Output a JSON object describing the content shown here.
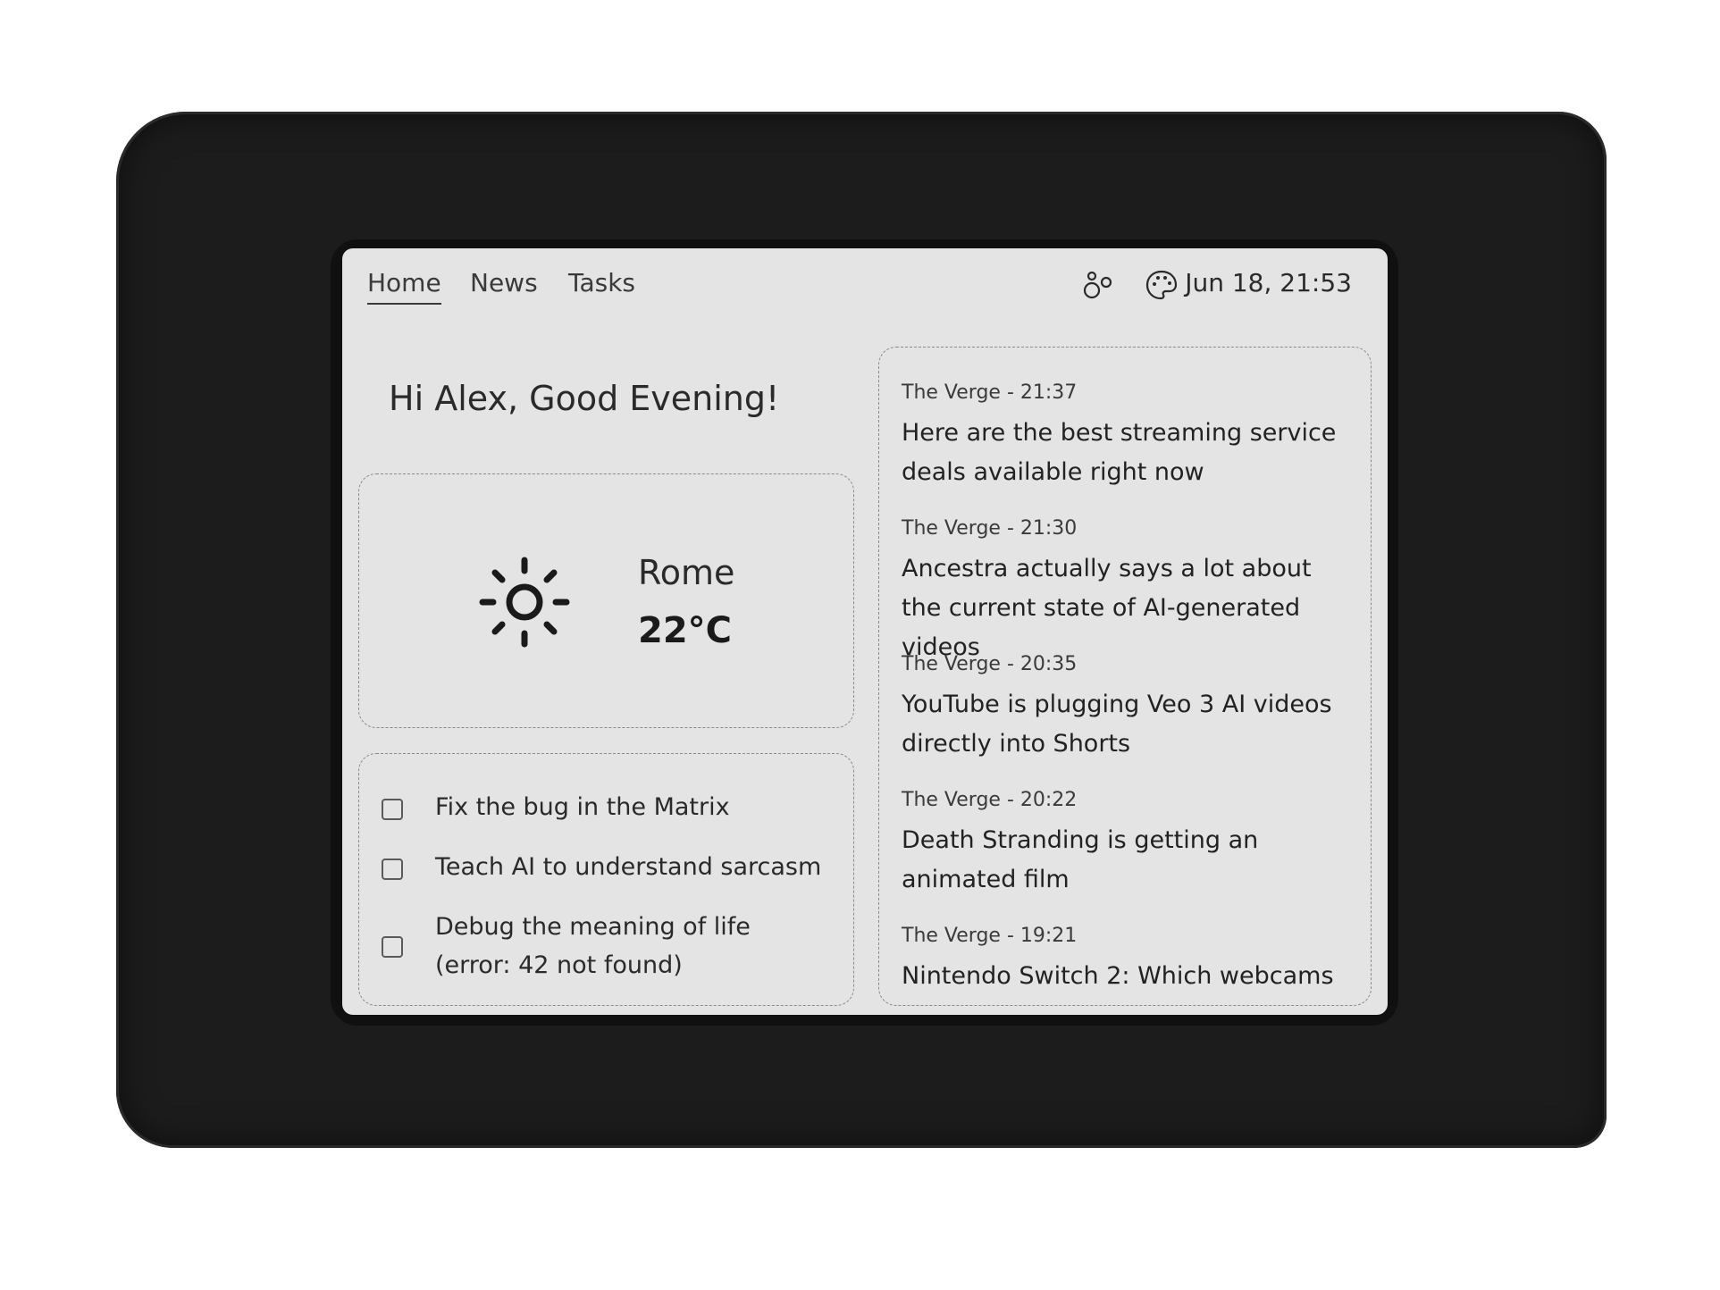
{
  "nav": {
    "tabs": [
      {
        "label": "Home",
        "active": true
      },
      {
        "label": "News",
        "active": false
      },
      {
        "label": "Tasks",
        "active": false
      }
    ],
    "icons": [
      "bubbles-icon",
      "palette-icon"
    ],
    "datetime": "Jun 18, 21:53"
  },
  "greeting": "Hi Alex, Good Evening!",
  "weather": {
    "icon": "sun-icon",
    "city": "Rome",
    "temperature": "22°C"
  },
  "tasks": [
    {
      "label": "Fix the bug in the Matrix",
      "checked": false
    },
    {
      "label": "Teach AI to understand sarcasm",
      "checked": false
    },
    {
      "label": "Debug the meaning of life (error: 42 not found)",
      "checked": false
    }
  ],
  "news": [
    {
      "meta": "The Verge - 21:37",
      "title": "Here are the best streaming service deals available right now"
    },
    {
      "meta": "The Verge - 21:30",
      "title": "Ancestra actually says a lot about the current state of AI-generated videos"
    },
    {
      "meta": "The Verge - 20:35",
      "title": "YouTube is plugging Veo 3 AI videos directly into Shorts"
    },
    {
      "meta": "The Verge - 20:22",
      "title": "Death Stranding is getting an animated film"
    },
    {
      "meta": "The Verge - 19:21",
      "title": "Nintendo Switch 2: Which webcams"
    }
  ],
  "colors": {
    "screen": "#e4e4e4",
    "bezel": "#1c1c1c",
    "text": "#2a2a2a"
  }
}
